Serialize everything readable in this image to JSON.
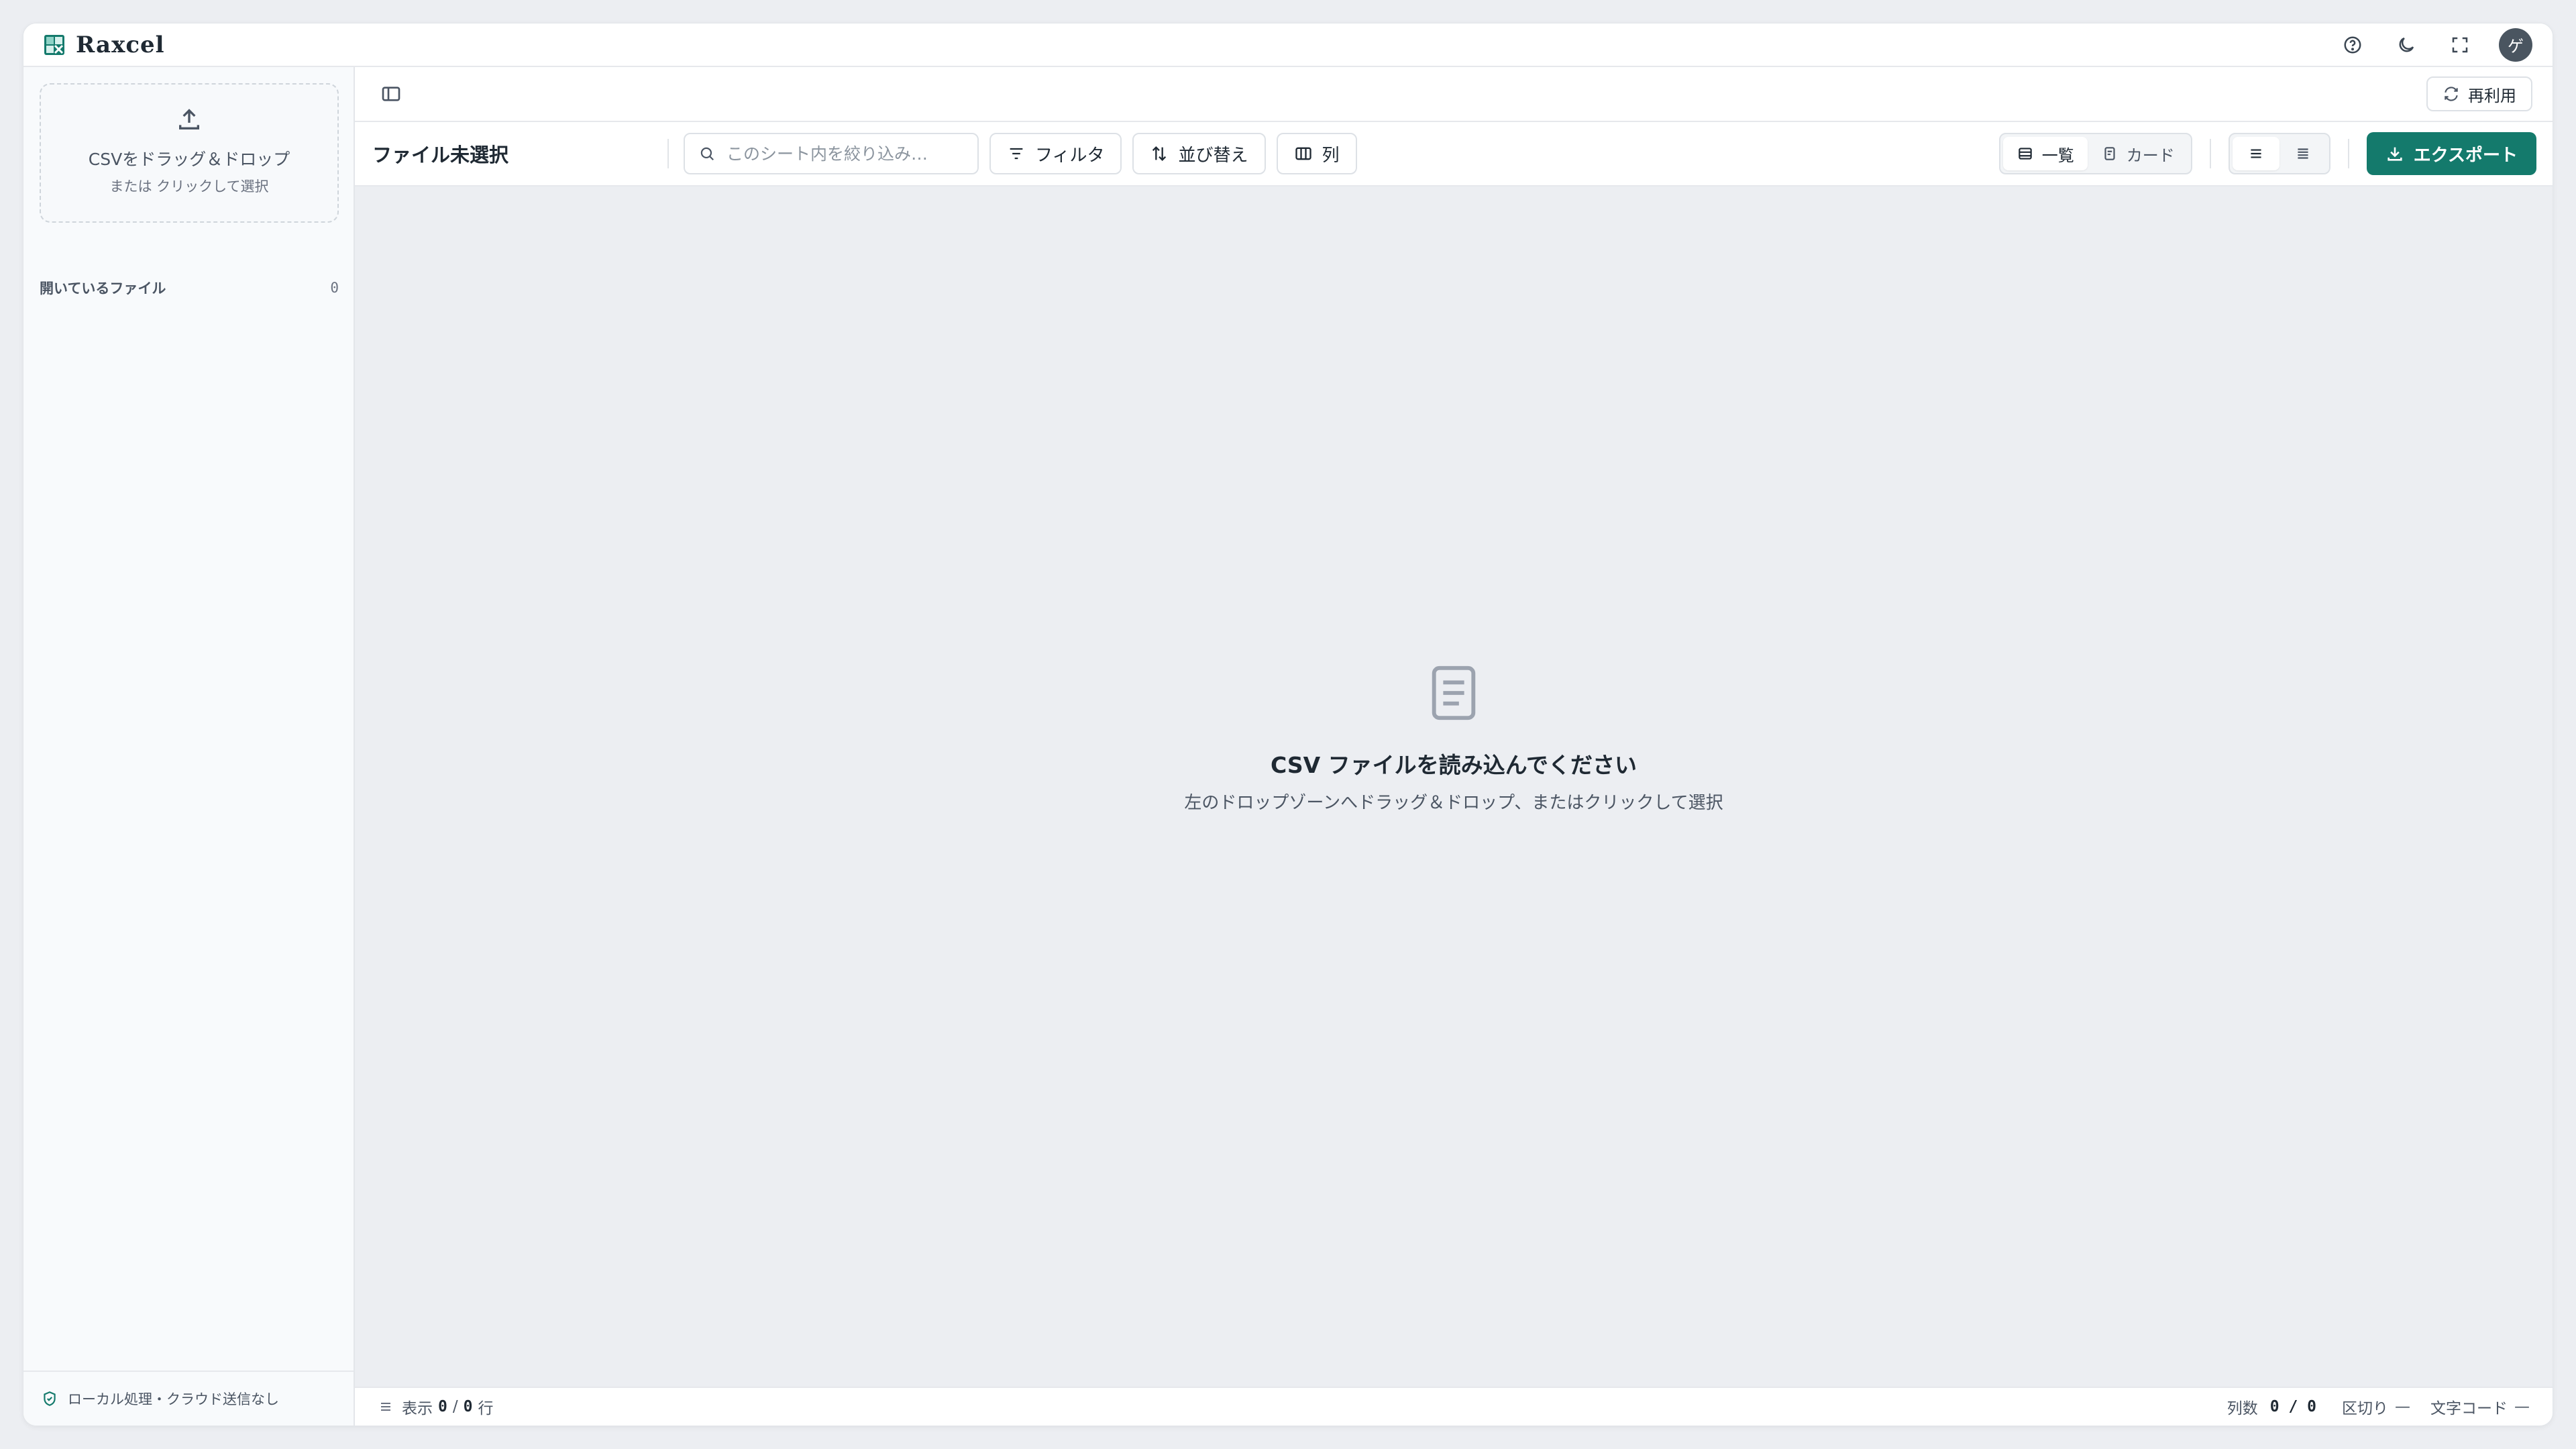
{
  "app": {
    "name": "Raxcel"
  },
  "titlebar": {
    "icons": [
      "help-icon",
      "moon-icon",
      "fullscreen-icon"
    ],
    "avatar_initial": "ゲ"
  },
  "sidebar": {
    "dropzone_main": "CSVをドラッグ＆ドロップ",
    "dropzone_sub": "または クリックして選択",
    "open_files_label": "開いているファイル",
    "open_files_count": "0",
    "footer_text": "ローカル処理・クラウド送信なし"
  },
  "topstrip": {
    "reuse_label": "再利用"
  },
  "toolbar": {
    "file_label": "ファイル未選択",
    "search_placeholder": "このシート内を絞り込み…",
    "filter_label": "フィルタ",
    "sort_label": "並び替え",
    "columns_label": "列",
    "view_list_label": "一覧",
    "view_card_label": "カード",
    "export_label": "エクスポート"
  },
  "empty_state": {
    "title": "CSV ファイルを読み込んでください",
    "subtitle": "左のドロップゾーンへドラッグ＆ドロップ、またはクリックして選択"
  },
  "statusbar": {
    "display_label": "表示",
    "shown_rows": "0",
    "slash": "/",
    "total_rows": "0",
    "rows_unit": "行",
    "columns_label": "列数",
    "columns_value": "0 / 0",
    "delimiter_label": "区切り",
    "delimiter_value": "—",
    "encoding_label": "文字コード",
    "encoding_value": "—"
  },
  "colors": {
    "accent": "#147a6c",
    "background": "#eceef2"
  }
}
